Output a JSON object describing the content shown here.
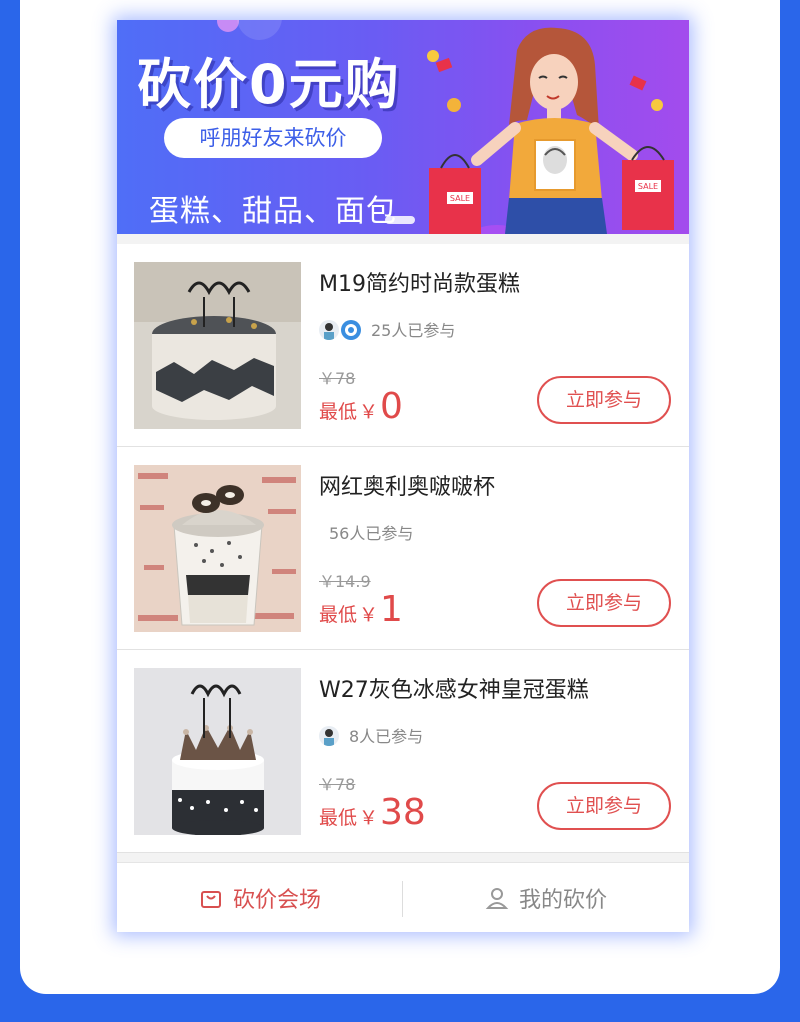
{
  "colors": {
    "page_bg": "#2a66ea",
    "accent_red": "#e05050",
    "banner_start": "#4f6ef7",
    "banner_end": "#a34ced"
  },
  "banner": {
    "title": "砍价0元购",
    "pill": "呼朋好友来砍价",
    "subtitle": "蛋糕、甜品、面包",
    "sale_tag": "SALE"
  },
  "products": [
    {
      "title": "M19简约时尚款蛋糕",
      "participants": "25人已参与",
      "original_price": "￥78",
      "low_label": "最低",
      "currency": "￥",
      "low_price": "0",
      "button": "立即参与",
      "avatars": 2
    },
    {
      "title": "网红奥利奥啵啵杯",
      "participants": "56人已参与",
      "original_price": "￥14.9",
      "low_label": "最低",
      "currency": "￥",
      "low_price": "1",
      "button": "立即参与",
      "avatars": 0
    },
    {
      "title": "W27灰色冰感女神皇冠蛋糕",
      "participants": "8人已参与",
      "original_price": "￥78",
      "low_label": "最低",
      "currency": "￥",
      "low_price": "38",
      "button": "立即参与",
      "avatars": 1
    }
  ],
  "tabbar": {
    "tab1_label": "砍价会场",
    "tab1_icon": "shopping-bag-icon",
    "tab2_label": "我的砍价",
    "tab2_icon": "user-icon"
  }
}
